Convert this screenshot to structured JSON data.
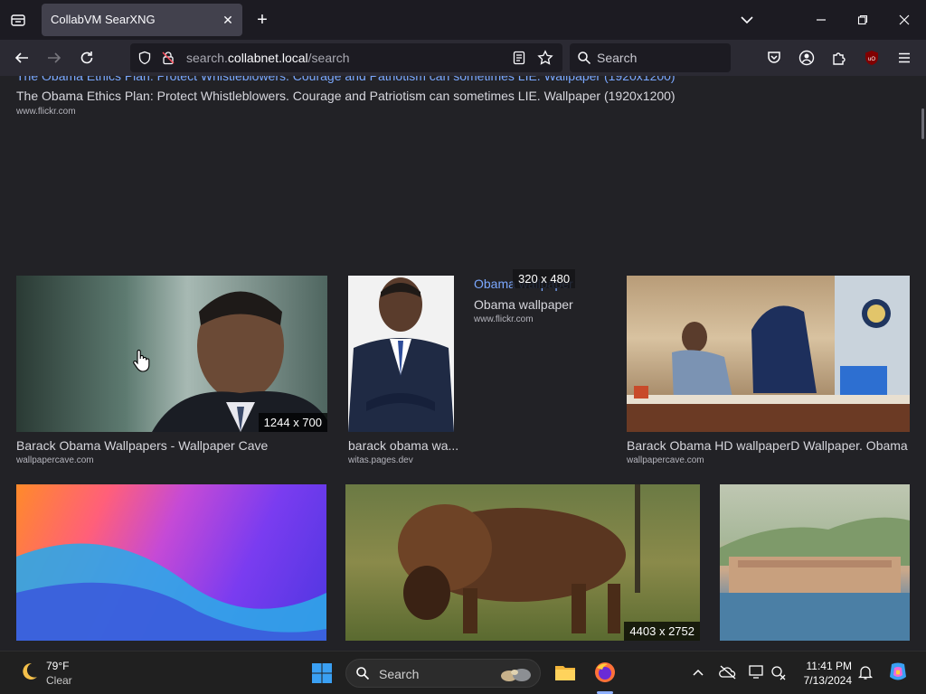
{
  "browser": {
    "tab_title": "CollabVM SearXNG",
    "url_prefix": "search.",
    "url_host": "collabnet.local",
    "url_path": "/search",
    "search_placeholder": "Search"
  },
  "results": {
    "prev_title_link": "The Obama Ethics Plan: Protect Whistleblowers. Courage and Patriotism can sometimes LIE. Wallpaper (1920x1200)",
    "prev_title": "The Obama Ethics Plan: Protect Whistleblowers. Courage and Patriotism can sometimes LIE. Wallpaper (1920x1200)",
    "prev_url": "www.flickr.com",
    "images": [
      {
        "caption": "Barack Obama Wallpapers - Wallpaper Cave",
        "source": "wallpapercave.com",
        "dims": "1244 x 700"
      },
      {
        "caption": "barack obama wa...",
        "source": "witas.pages.dev"
      },
      {
        "caption": "Barack Obama HD wallpaperD Wallpaper. Obama",
        "source": "wallpapercave.com"
      },
      {
        "caption": "",
        "source": ""
      },
      {
        "caption": "",
        "source": "",
        "dims": "4403 x 2752"
      },
      {
        "caption": "",
        "source": ""
      }
    ],
    "tooltip": {
      "title": "Obama wallpaper",
      "dims": "320 x 480",
      "subtitle": "Obama wallpaper",
      "source": "www.flickr.com"
    }
  },
  "taskbar": {
    "temp": "79°F",
    "condition": "Clear",
    "search_label": "Search",
    "time": "11:41 PM",
    "date": "7/13/2024"
  },
  "colors": {
    "link": "#7ba8ff",
    "background": "#222226",
    "firefox_accent": "#ff7139"
  }
}
